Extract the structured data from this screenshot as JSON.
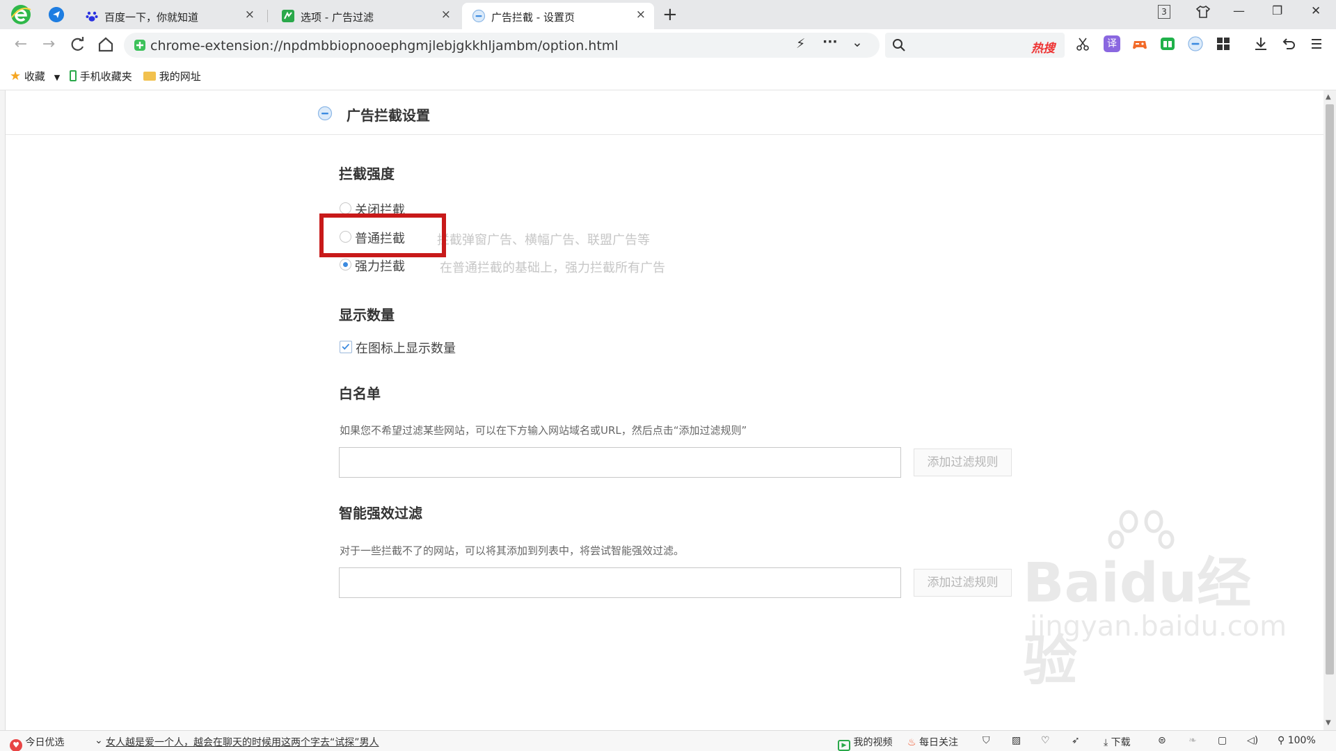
{
  "tabs": [
    {
      "title": "百度一下，你就知道",
      "close": "×"
    },
    {
      "title": "选项 - 广告过滤",
      "close": "×"
    },
    {
      "title": "广告拦截 - 设置页",
      "close": "×"
    }
  ],
  "new_tab_label": "+",
  "window_controls": {
    "tab_count": "3",
    "minimize": "—",
    "maximize": "❐",
    "close": "✕"
  },
  "address": {
    "url": "chrome-extension://npdmbbiopnooephgmjlebjgkkhljambm/option.html"
  },
  "search": {
    "hot_label": "热搜"
  },
  "bookmarks": {
    "favorites": "收藏",
    "mobile": "手机收藏夹",
    "my_sites": "我的网址"
  },
  "page": {
    "header_title": "广告拦截设置",
    "strength": {
      "title": "拦截强度",
      "options": [
        {
          "label": "关闭拦截",
          "desc": "",
          "selected": false
        },
        {
          "label": "普通拦截",
          "desc": "拦截弹窗广告、横幅广告、联盟广告等",
          "selected": false
        },
        {
          "label": "强力拦截",
          "desc": "在普通拦截的基础上，强力拦截所有广告",
          "selected": true
        }
      ]
    },
    "count": {
      "title": "显示数量",
      "checkbox_label": "在图标上显示数量",
      "checked": true
    },
    "whitelist": {
      "title": "白名单",
      "desc": "如果您不希望过滤某些网站，可以在下方输入网站域名或URL，然后点击“添加过滤规则”",
      "input_value": "",
      "button": "添加过滤规则"
    },
    "smart": {
      "title": "智能强效过滤",
      "desc": "对于一些拦截不了的网站，可以将其添加到列表中，将尝试智能强效过滤。",
      "input_value": "",
      "button": "添加过滤规则"
    }
  },
  "watermark": {
    "brand": "Baidu经验",
    "url": "jingyan.baidu.com"
  },
  "statusbar": {
    "today": "今日优选",
    "news": "女人越是爱一个人，越会在聊天的时候用这两个字去“试探”男人",
    "my_video": "我的视频",
    "daily_follow": "每日关注",
    "download": "下载",
    "zoom": "100%"
  },
  "colors": {
    "accent": "#3c8be0",
    "annotation": "#c81a1a",
    "hot": "#e33333"
  }
}
